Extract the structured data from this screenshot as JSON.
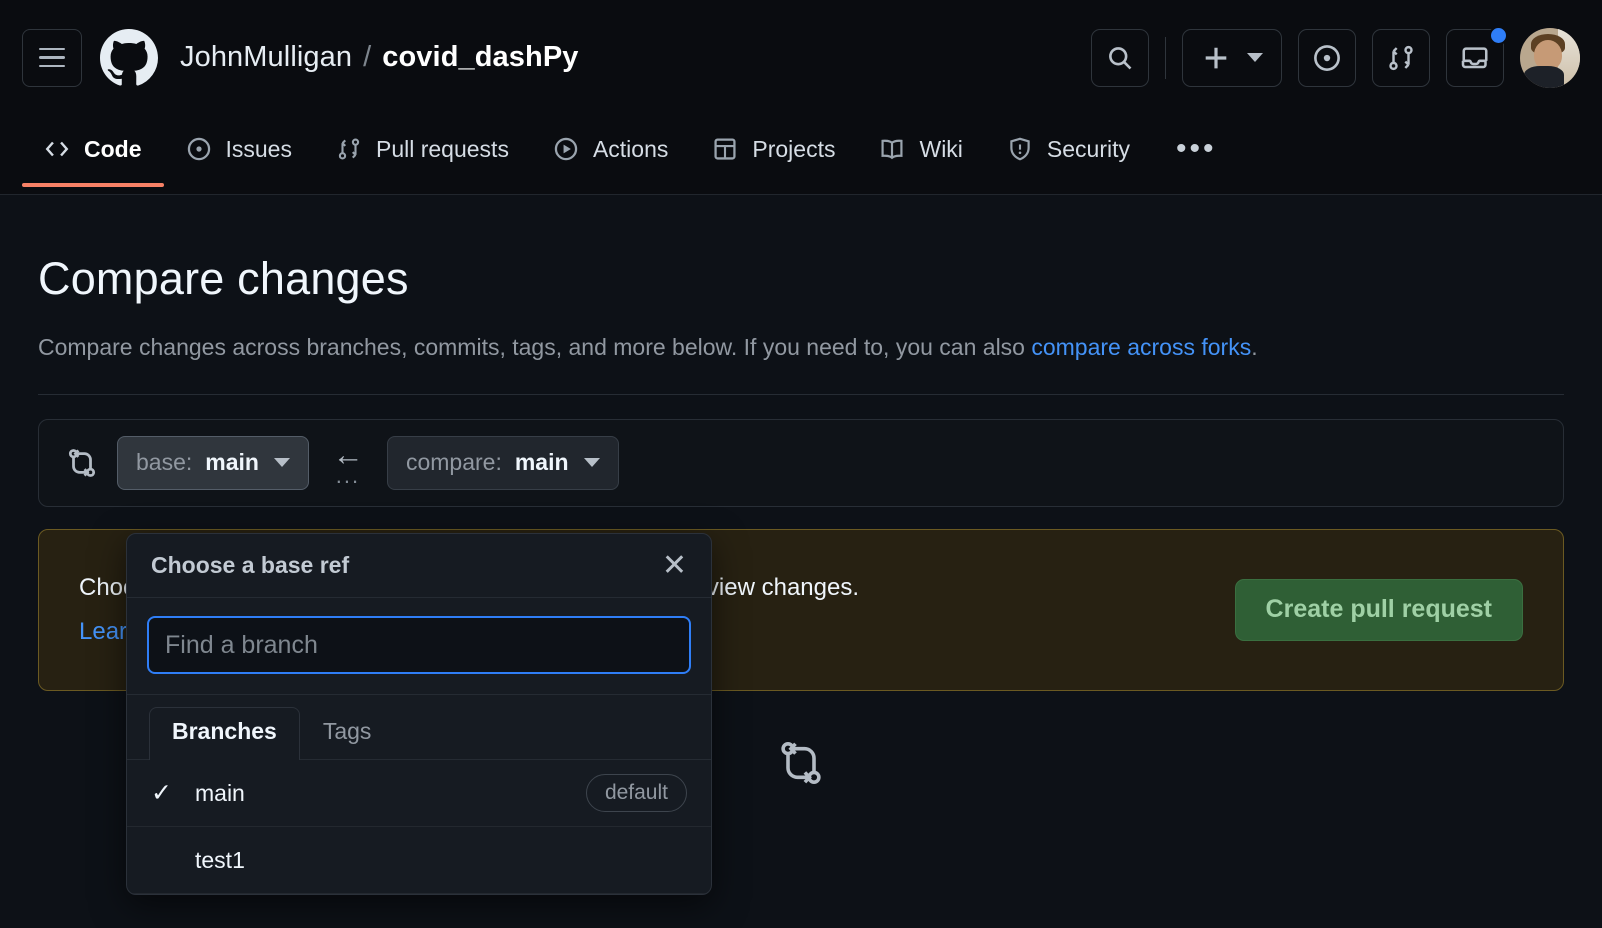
{
  "header": {
    "menu_icon": "hamburger-icon",
    "logo_icon": "github-octocat-icon",
    "owner": "JohnMulligan",
    "separator": "/",
    "repo": "covid_dashPy",
    "actions": [
      {
        "name": "search-button",
        "icon": "search-icon"
      },
      {
        "name": "create-new-button",
        "icon": "plus-icon"
      },
      {
        "name": "issues-button",
        "icon": "dot-circle-icon"
      },
      {
        "name": "pull-requests-button",
        "icon": "git-pull-request-icon"
      },
      {
        "name": "notifications-button",
        "icon": "inbox-icon",
        "has_unread_dot": true
      },
      {
        "name": "user-avatar",
        "icon": "avatar-image"
      }
    ]
  },
  "repo_nav": {
    "tabs": [
      {
        "label": "Code",
        "icon": "code-icon",
        "active": true
      },
      {
        "label": "Issues",
        "icon": "issue-opened-icon",
        "active": false
      },
      {
        "label": "Pull requests",
        "icon": "git-pull-request-icon",
        "active": false
      },
      {
        "label": "Actions",
        "icon": "play-icon",
        "active": false
      },
      {
        "label": "Projects",
        "icon": "table-icon",
        "active": false
      },
      {
        "label": "Wiki",
        "icon": "book-icon",
        "active": false
      },
      {
        "label": "Security",
        "icon": "shield-icon",
        "active": false
      }
    ],
    "overflow_label": "•••"
  },
  "main": {
    "title": "Compare changes",
    "description": "Compare changes across branches, commits, tags, and more below. If you need to, you can also ",
    "description_link": "compare across forks",
    "description_end": "."
  },
  "compare_bar": {
    "icon": "git-compare-icon",
    "base": {
      "prefix": "base:",
      "value": "main",
      "caret": "chevron-down-icon"
    },
    "arrow": "←",
    "arrow_dots": "...",
    "compare": {
      "prefix": "compare:",
      "value": "main",
      "caret": "chevron-down-icon"
    }
  },
  "banner": {
    "message": "Choose different branches or forks above to discuss and review changes.",
    "link": "Learn more about diff comparisons here.",
    "button_label": "Create pull request"
  },
  "blankslate": {
    "icon": "git-compare-icon"
  },
  "dropdown": {
    "title": "Choose a base ref",
    "close_icon": "close-icon",
    "search_placeholder": "Find a branch",
    "search_value": "",
    "tabs": [
      {
        "label": "Branches",
        "active": true
      },
      {
        "label": "Tags",
        "active": false
      }
    ],
    "items": [
      {
        "label": "main",
        "selected": true,
        "check": "✓",
        "badge": "default"
      },
      {
        "label": "test1",
        "selected": false,
        "check": "",
        "badge": ""
      }
    ]
  },
  "colors": {
    "bg": "#0d1117",
    "header_bg": "#0a0c10",
    "accent_orange": "#f78166",
    "link_blue": "#4493f8",
    "focus_blue": "#2f7ef7",
    "banner_bg": "#272112",
    "banner_border": "#6b5a22",
    "button_green": "#2f5f35",
    "notification_blue": "#2f7ef7"
  }
}
